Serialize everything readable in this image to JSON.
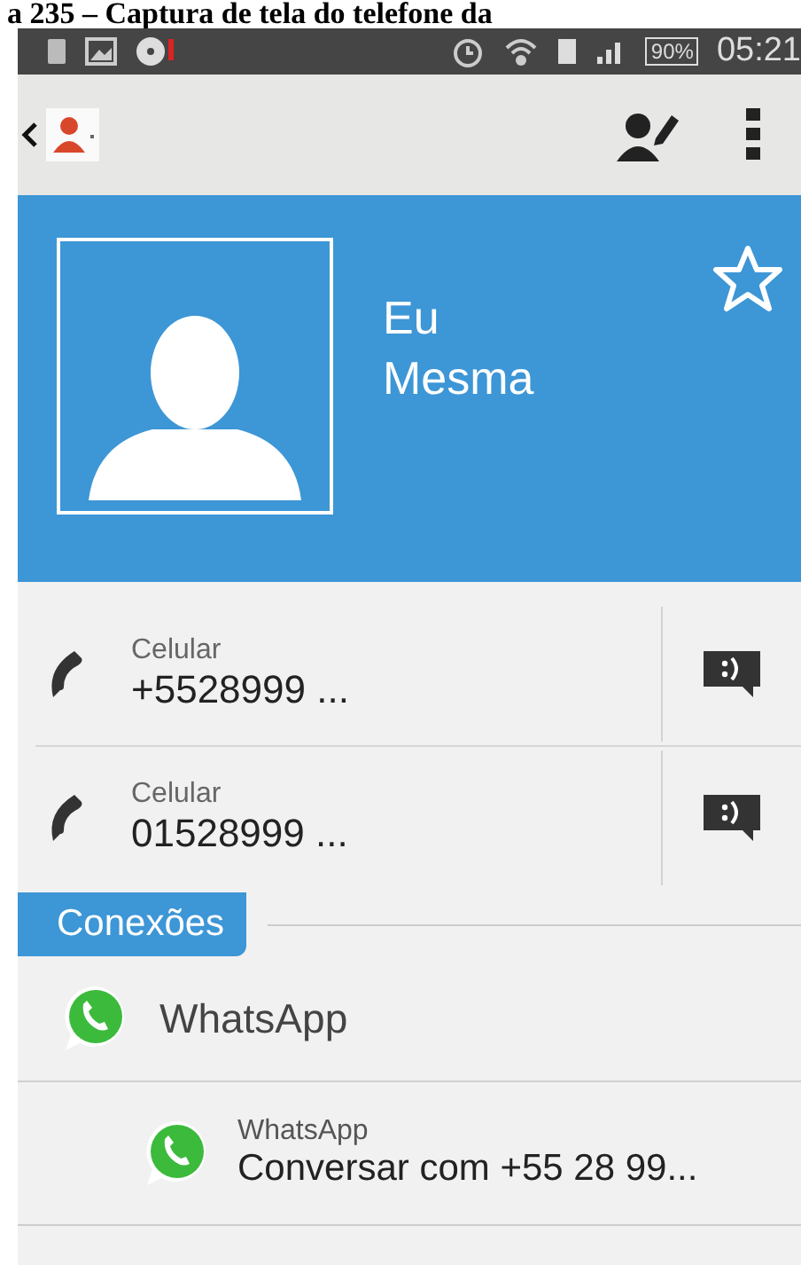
{
  "caption": "a 235 – Captura de tela do telefone da",
  "status_bar": {
    "battery": "90%",
    "time": "05:21"
  },
  "contact": {
    "first_name": "Eu",
    "last_name": "Mesma",
    "favorite": false
  },
  "phones": [
    {
      "label": "Celular",
      "number": "+5528999 ..."
    },
    {
      "label": "Celular",
      "number": "01528999 ..."
    }
  ],
  "section": {
    "title": "Conexões"
  },
  "connections": [
    {
      "kind": "app",
      "name": "WhatsApp"
    },
    {
      "kind": "action",
      "app": "WhatsApp",
      "text": "Conversar com +55 28 99..."
    }
  ]
}
